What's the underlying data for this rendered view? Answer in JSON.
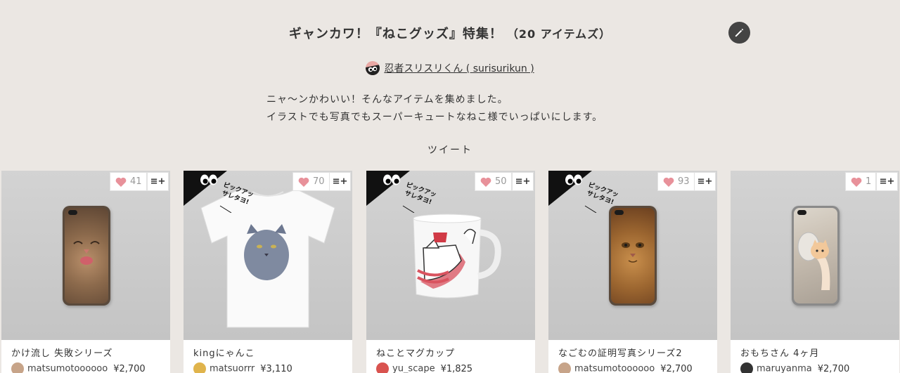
{
  "header": {
    "title": "ギャンカワ！『ねこグッズ』特集！",
    "count": "（20 アイテムズ）",
    "author_name": "忍者スリスリくん ( surisurikun )",
    "description_line1": "ニャ〜ンかわいい！そんなアイテムを集めました。",
    "description_line2": "イラストでも写真でもスーパーキュートなねこ様でいっぱいにします。",
    "tweet_label": "ツイート"
  },
  "pickup_badge_text": "ピックアップ サレタヨ!",
  "colors": {
    "background": "#ebe7e3",
    "heart": "#e8919a",
    "edit_button": "#444444"
  },
  "cards": [
    {
      "name": "かけ流し 失敗シリーズ",
      "seller": "matsumotoooooo",
      "price": "¥2,700",
      "likes": "41",
      "add_label": "≡+",
      "pickup": false
    },
    {
      "name": "kingにゃんこ",
      "seller": "matsuorrr",
      "price": "¥3,110",
      "likes": "70",
      "add_label": "≡+",
      "pickup": true
    },
    {
      "name": "ねことマグカップ",
      "seller": "yu_scape",
      "price": "¥1,825",
      "likes": "50",
      "add_label": "≡+",
      "pickup": true
    },
    {
      "name": "なごむの証明写真シリーズ2",
      "seller": "matsumotoooooo",
      "price": "¥2,700",
      "likes": "93",
      "add_label": "≡+",
      "pickup": true
    },
    {
      "name": "おもちさん 4ヶ月",
      "seller": "maruyanma",
      "price": "¥2,700",
      "likes": "1",
      "add_label": "≡+",
      "pickup": false
    }
  ]
}
